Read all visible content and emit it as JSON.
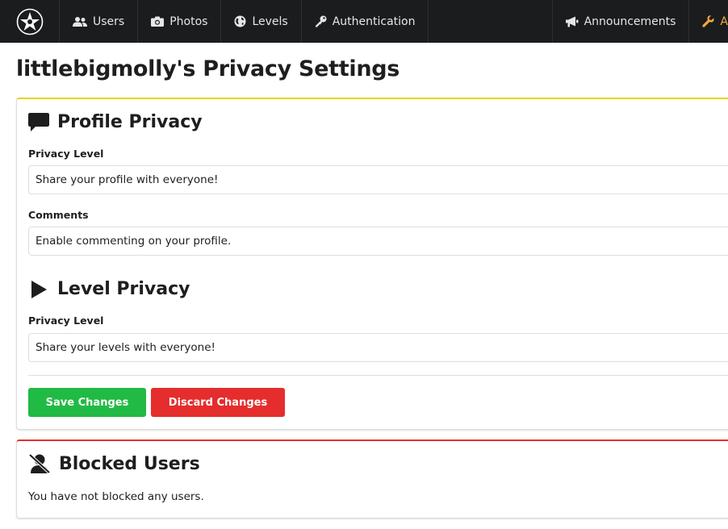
{
  "nav": {
    "items": [
      {
        "label": "Users",
        "icon": "users-icon"
      },
      {
        "label": "Photos",
        "icon": "camera-icon"
      },
      {
        "label": "Levels",
        "icon": "globe-icon"
      },
      {
        "label": "Authentication",
        "icon": "key-icon"
      }
    ],
    "right_items": [
      {
        "label": "Announcements",
        "icon": "bullhorn-icon"
      },
      {
        "label": "A",
        "icon": "wrench-icon"
      }
    ],
    "colors": {
      "background": "#1b1c1d",
      "text": "#e6e6e6",
      "admin": "#f2a93b"
    }
  },
  "page": {
    "title": "littlebigmolly's Privacy Settings"
  },
  "profile_privacy": {
    "heading": "Profile Privacy",
    "icon": "comment-icon",
    "privacy_level_label": "Privacy Level",
    "privacy_level_value": "Share your profile with everyone!",
    "comments_label": "Comments",
    "comments_value": "Enable commenting on your profile."
  },
  "level_privacy": {
    "heading": "Level Privacy",
    "icon": "play-icon",
    "privacy_level_label": "Privacy Level",
    "privacy_level_value": "Share your levels with everyone!"
  },
  "actions": {
    "save_label": "Save Changes",
    "discard_label": "Discard Changes",
    "save_color": "#21ba45",
    "discard_color": "#e52d2d"
  },
  "blocked_users": {
    "heading": "Blocked Users",
    "icon": "user-slash-icon",
    "empty_text": "You have not blocked any users."
  },
  "accents": {
    "privacy_border": "#e6d31a",
    "blocked_border": "#e53030"
  }
}
